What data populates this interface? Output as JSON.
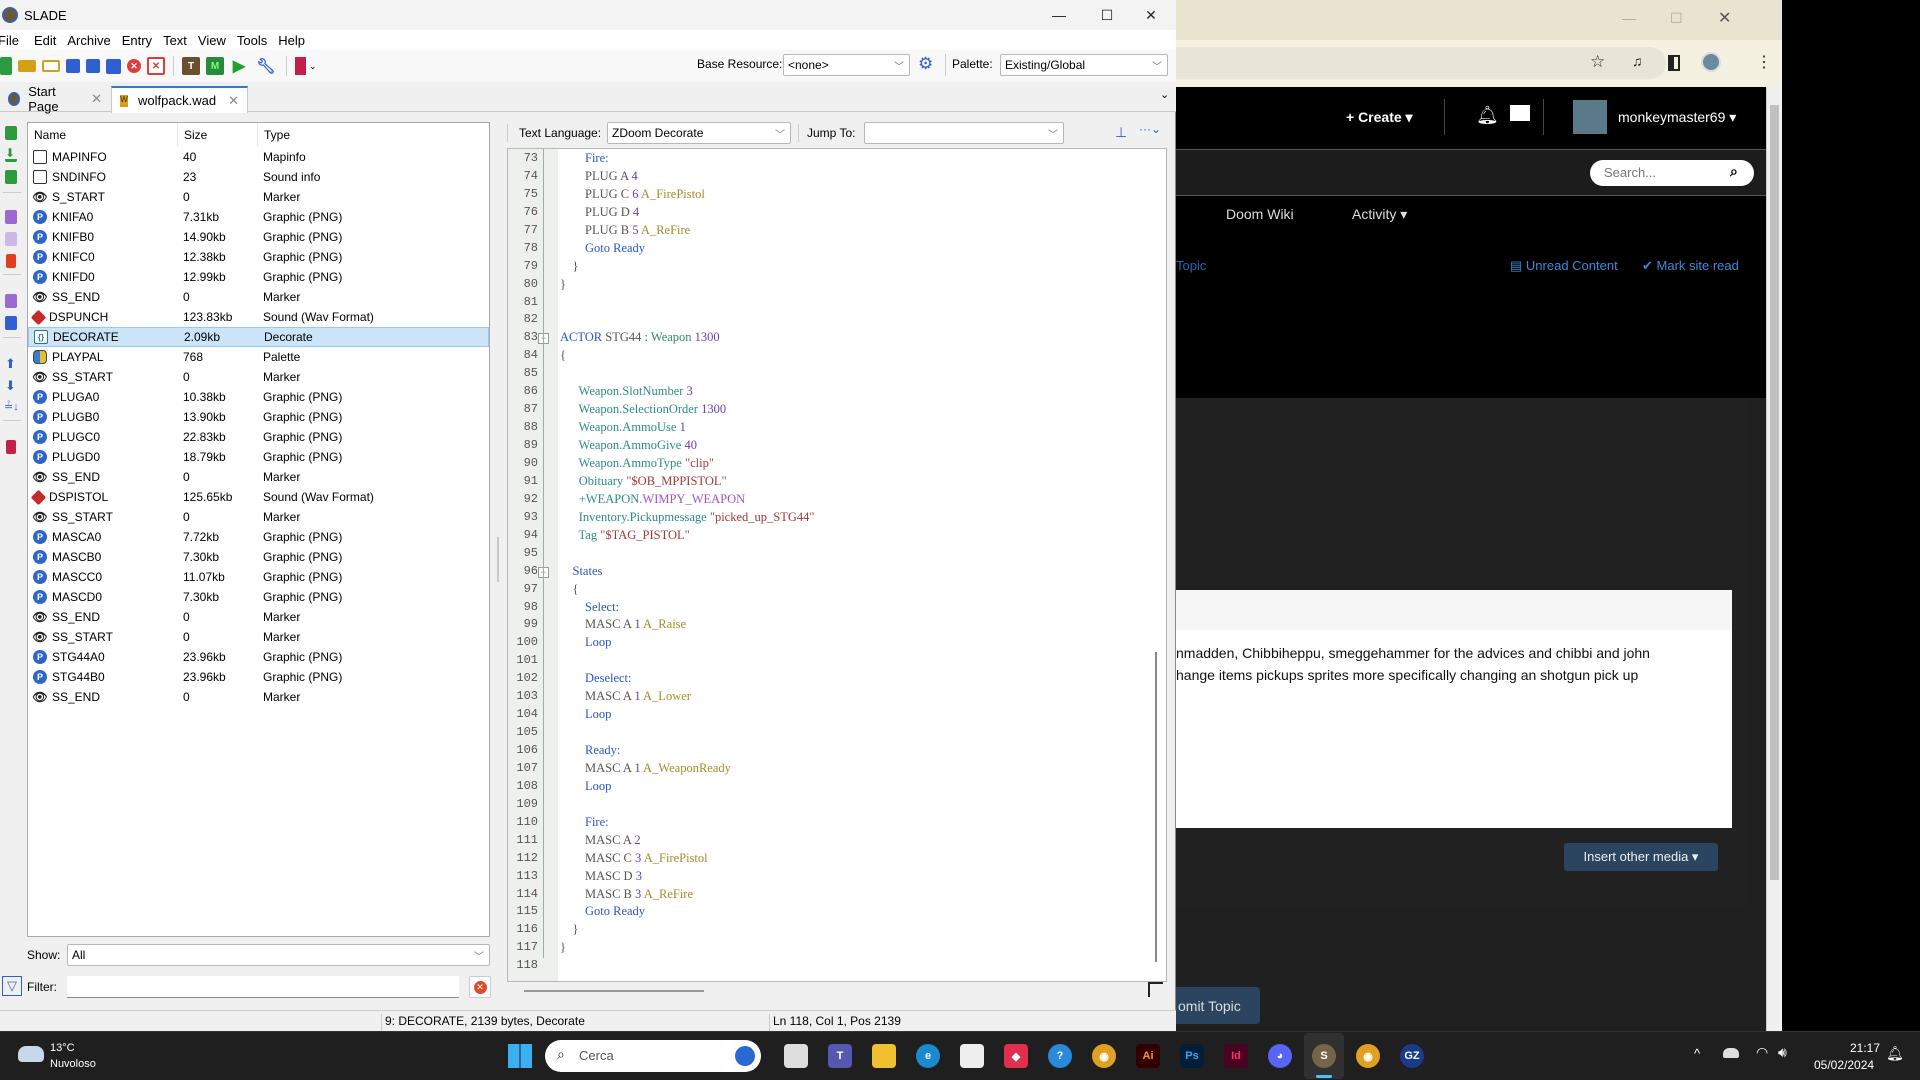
{
  "slade": {
    "title": "SLADE",
    "window_controls": {
      "minimize": "—",
      "maximize": "☐",
      "close": "✕"
    },
    "menu": [
      "File",
      "Edit",
      "Archive",
      "Entry",
      "Text",
      "View",
      "Tools",
      "Help"
    ],
    "toolbar": {
      "base_resource_label": "Base Resource:",
      "base_resource_value": "<none>",
      "palette_label": "Palette:",
      "palette_value": "Existing/Global"
    },
    "tabs": [
      {
        "label": "Start Page",
        "close": "✕"
      },
      {
        "label": "wolfpack.wad",
        "close": "✕"
      }
    ],
    "entry_list": {
      "columns": [
        "Name",
        "Size",
        "Type"
      ],
      "selected_index": 9,
      "rows": [
        {
          "icon": "text",
          "name": "MAPINFO",
          "size": "40",
          "type": "Mapinfo"
        },
        {
          "icon": "text",
          "name": "SNDINFO",
          "size": "23",
          "type": "Sound info"
        },
        {
          "icon": "marker",
          "name": "S_START",
          "size": "0",
          "type": "Marker"
        },
        {
          "icon": "png",
          "name": "KNIFA0",
          "size": "7.31kb",
          "type": "Graphic (PNG)"
        },
        {
          "icon": "png",
          "name": "KNIFB0",
          "size": "14.90kb",
          "type": "Graphic (PNG)"
        },
        {
          "icon": "png",
          "name": "KNIFC0",
          "size": "12.38kb",
          "type": "Graphic (PNG)"
        },
        {
          "icon": "png",
          "name": "KNIFD0",
          "size": "12.99kb",
          "type": "Graphic (PNG)"
        },
        {
          "icon": "marker",
          "name": "SS_END",
          "size": "0",
          "type": "Marker"
        },
        {
          "icon": "sound",
          "name": "DSPUNCH",
          "size": "123.83kb",
          "type": "Sound (Wav Format)"
        },
        {
          "icon": "dec",
          "name": "DECORATE",
          "size": "2.09kb",
          "type": "Decorate"
        },
        {
          "icon": "pal",
          "name": "PLAYPAL",
          "size": "768",
          "type": "Palette"
        },
        {
          "icon": "marker",
          "name": "SS_START",
          "size": "0",
          "type": "Marker"
        },
        {
          "icon": "png",
          "name": "PLUGA0",
          "size": "10.38kb",
          "type": "Graphic (PNG)"
        },
        {
          "icon": "png",
          "name": "PLUGB0",
          "size": "13.90kb",
          "type": "Graphic (PNG)"
        },
        {
          "icon": "png",
          "name": "PLUGC0",
          "size": "22.83kb",
          "type": "Graphic (PNG)"
        },
        {
          "icon": "png",
          "name": "PLUGD0",
          "size": "18.79kb",
          "type": "Graphic (PNG)"
        },
        {
          "icon": "marker",
          "name": "SS_END",
          "size": "0",
          "type": "Marker"
        },
        {
          "icon": "sound",
          "name": "DSPISTOL",
          "size": "125.65kb",
          "type": "Sound (Wav Format)"
        },
        {
          "icon": "marker",
          "name": "SS_START",
          "size": "0",
          "type": "Marker"
        },
        {
          "icon": "png",
          "name": "MASCA0",
          "size": "7.72kb",
          "type": "Graphic (PNG)"
        },
        {
          "icon": "png",
          "name": "MASCB0",
          "size": "7.30kb",
          "type": "Graphic (PNG)"
        },
        {
          "icon": "png",
          "name": "MASCC0",
          "size": "11.07kb",
          "type": "Graphic (PNG)"
        },
        {
          "icon": "png",
          "name": "MASCD0",
          "size": "7.30kb",
          "type": "Graphic (PNG)"
        },
        {
          "icon": "marker",
          "name": "SS_END",
          "size": "0",
          "type": "Marker"
        },
        {
          "icon": "marker",
          "name": "SS_START",
          "size": "0",
          "type": "Marker"
        },
        {
          "icon": "png",
          "name": "STG44A0",
          "size": "23.96kb",
          "type": "Graphic (PNG)"
        },
        {
          "icon": "png",
          "name": "STG44B0",
          "size": "23.96kb",
          "type": "Graphic (PNG)"
        },
        {
          "icon": "marker",
          "name": "SS_END",
          "size": "0",
          "type": "Marker"
        }
      ]
    },
    "show": {
      "label": "Show:",
      "value": "All"
    },
    "filter": {
      "label": "Filter:",
      "value": ""
    },
    "text_editor": {
      "language_label": "Text Language:",
      "language_value": "ZDoom Decorate",
      "jump_label": "Jump To:",
      "jump_value": "",
      "first_line": 73,
      "fold_markers": [
        83,
        96
      ],
      "lines": [
        [
          [
            "        ",
            ""
          ],
          [
            "Fire:",
            "kw"
          ]
        ],
        [
          [
            "        PLUG A ",
            ""
          ],
          [
            "4",
            "num"
          ]
        ],
        [
          [
            "        PLUG C ",
            ""
          ],
          [
            "6",
            "num"
          ],
          [
            " ",
            ""
          ],
          [
            "A_FirePistol",
            "fn"
          ]
        ],
        [
          [
            "        PLUG D ",
            ""
          ],
          [
            "4",
            "num"
          ]
        ],
        [
          [
            "        PLUG B ",
            ""
          ],
          [
            "5",
            "num"
          ],
          [
            " ",
            ""
          ],
          [
            "A_ReFire",
            "fn"
          ]
        ],
        [
          [
            "        ",
            ""
          ],
          [
            "Goto Ready",
            "kw"
          ]
        ],
        [
          [
            "    }",
            ""
          ]
        ],
        [
          [
            "}",
            ""
          ]
        ],
        [
          [
            "",
            ""
          ]
        ],
        [
          [
            "",
            ""
          ]
        ],
        [
          [
            "ACTOR",
            "kw"
          ],
          [
            " STG44 : ",
            ""
          ],
          [
            "Weapon",
            "typ"
          ],
          [
            " ",
            ""
          ],
          [
            "1300",
            "num"
          ]
        ],
        [
          [
            "{",
            ""
          ]
        ],
        [
          [
            "",
            ""
          ]
        ],
        [
          [
            "      ",
            ""
          ],
          [
            "Weapon.SlotNumber",
            "prop"
          ],
          [
            " ",
            ""
          ],
          [
            "3",
            "num"
          ]
        ],
        [
          [
            "      ",
            ""
          ],
          [
            "Weapon.SelectionOrder",
            "prop"
          ],
          [
            " ",
            ""
          ],
          [
            "1300",
            "num"
          ]
        ],
        [
          [
            "      ",
            ""
          ],
          [
            "Weapon.AmmoUse",
            "prop"
          ],
          [
            " ",
            ""
          ],
          [
            "1",
            "num"
          ]
        ],
        [
          [
            "      ",
            ""
          ],
          [
            "Weapon.AmmoGive",
            "prop"
          ],
          [
            " ",
            ""
          ],
          [
            "40",
            "num"
          ]
        ],
        [
          [
            "      ",
            ""
          ],
          [
            "Weapon.AmmoType",
            "prop"
          ],
          [
            " ",
            ""
          ],
          [
            "\"clip\"",
            "str"
          ]
        ],
        [
          [
            "      ",
            ""
          ],
          [
            "Obituary",
            "prop"
          ],
          [
            " ",
            ""
          ],
          [
            "\"$OB_MPPISTOL\"",
            "str"
          ]
        ],
        [
          [
            "      ",
            ""
          ],
          [
            "+WEAPON.",
            "prop"
          ],
          [
            "WIMPY_WEAPON",
            "flag"
          ]
        ],
        [
          [
            "      ",
            ""
          ],
          [
            "Inventory.Pickupmessage",
            "prop"
          ],
          [
            " ",
            ""
          ],
          [
            "\"picked_up_STG44\"",
            "str"
          ]
        ],
        [
          [
            "      ",
            ""
          ],
          [
            "Tag",
            "prop"
          ],
          [
            " ",
            ""
          ],
          [
            "\"$TAG_PISTOL\"",
            "str"
          ]
        ],
        [
          [
            "",
            ""
          ]
        ],
        [
          [
            "    ",
            ""
          ],
          [
            "States",
            "kw"
          ]
        ],
        [
          [
            "    {",
            ""
          ]
        ],
        [
          [
            "        ",
            ""
          ],
          [
            "Select:",
            "kw"
          ]
        ],
        [
          [
            "        MASC A ",
            ""
          ],
          [
            "1",
            "num"
          ],
          [
            " ",
            ""
          ],
          [
            "A_Raise",
            "fn"
          ]
        ],
        [
          [
            "        ",
            ""
          ],
          [
            "Loop",
            "kw"
          ]
        ],
        [
          [
            "",
            ""
          ]
        ],
        [
          [
            "        ",
            ""
          ],
          [
            "Deselect:",
            "kw"
          ]
        ],
        [
          [
            "        MASC A ",
            ""
          ],
          [
            "1",
            "num"
          ],
          [
            " ",
            ""
          ],
          [
            "A_Lower",
            "fn"
          ]
        ],
        [
          [
            "        ",
            ""
          ],
          [
            "Loop",
            "kw"
          ]
        ],
        [
          [
            "",
            ""
          ]
        ],
        [
          [
            "        ",
            ""
          ],
          [
            "Ready:",
            "kw"
          ]
        ],
        [
          [
            "        MASC A ",
            ""
          ],
          [
            "1",
            "num"
          ],
          [
            " ",
            ""
          ],
          [
            "A_WeaponReady",
            "fn"
          ]
        ],
        [
          [
            "        ",
            ""
          ],
          [
            "Loop",
            "kw"
          ]
        ],
        [
          [
            "",
            ""
          ]
        ],
        [
          [
            "        ",
            ""
          ],
          [
            "Fire:",
            "kw"
          ]
        ],
        [
          [
            "        MASC A ",
            ""
          ],
          [
            "2",
            "num"
          ]
        ],
        [
          [
            "        MASC C ",
            ""
          ],
          [
            "3",
            "num"
          ],
          [
            " ",
            ""
          ],
          [
            "A_FirePistol",
            "fn"
          ]
        ],
        [
          [
            "        MASC D ",
            ""
          ],
          [
            "3",
            "num"
          ]
        ],
        [
          [
            "        MASC B ",
            ""
          ],
          [
            "3",
            "num"
          ],
          [
            " ",
            ""
          ],
          [
            "A_ReFire",
            "fn"
          ]
        ],
        [
          [
            "        ",
            ""
          ],
          [
            "Goto Ready",
            "kw"
          ]
        ],
        [
          [
            "    }",
            ""
          ]
        ],
        [
          [
            "}",
            ""
          ]
        ],
        [
          [
            "",
            ""
          ]
        ]
      ]
    },
    "status": {
      "entry_info": "9: DECORATE, 2139 bytes, Decorate",
      "cursor_info": "Ln 118, Col 1, Pos 2139"
    }
  },
  "browser": {
    "window_controls": {
      "minimize": "—",
      "maximize": "☐",
      "close": "✕"
    },
    "header": {
      "create_label": "+ Create ▾",
      "username": "monkeymaster69 ▾",
      "search_placeholder": "Search..."
    },
    "nav": [
      "Doom Wiki",
      "Activity ▾"
    ],
    "subnav": {
      "partial_link": "Topic",
      "unread": "Unread Content",
      "mark_read": "✔ Mark site read"
    },
    "post_text": [
      "nmadden, Chibbiheppu, smeggehammer for the advices and chibbi and john",
      "hange items pickups sprites more specifically changing an shotgun pick up"
    ],
    "insert_media_button": "Insert other media ▾",
    "submit_button": "omit Topic"
  },
  "taskbar": {
    "weather_temp": "13°C",
    "weather_desc": "Nuvoloso",
    "search_placeholder": "Cerca",
    "time": "21:17",
    "date": "05/02/2024",
    "apps": [
      "task-view",
      "teams",
      "file-explorer",
      "edge",
      "store",
      "red-app",
      "help",
      "chrome",
      "illustrator",
      "photoshop",
      "indesign",
      "discord",
      "slade",
      "chrome-profile",
      "gzdoom"
    ]
  }
}
